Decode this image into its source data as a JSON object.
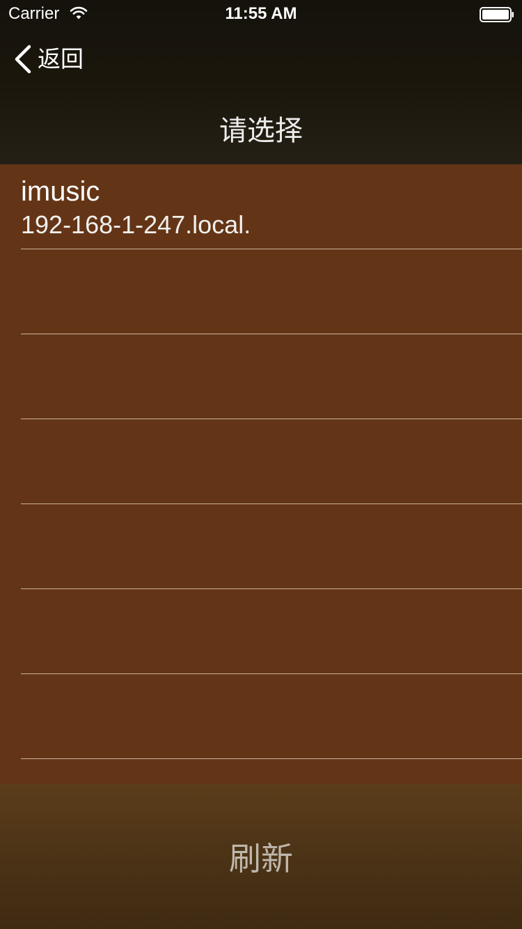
{
  "status_bar": {
    "carrier": "Carrier",
    "time": "11:55 AM",
    "wifi_icon": "wifi-icon",
    "battery_icon": "battery-icon"
  },
  "nav": {
    "back_label": "返回",
    "back_icon": "chevron-left-icon",
    "title": "请选择"
  },
  "list": {
    "items": [
      {
        "title": "imusic",
        "subtitle": "192-168-1-247.local."
      },
      {
        "title": "",
        "subtitle": ""
      },
      {
        "title": "",
        "subtitle": ""
      },
      {
        "title": "",
        "subtitle": ""
      },
      {
        "title": "",
        "subtitle": ""
      },
      {
        "title": "",
        "subtitle": ""
      },
      {
        "title": "",
        "subtitle": ""
      }
    ]
  },
  "footer": {
    "refresh_label": "刷新"
  },
  "colors": {
    "list_background": "#633516",
    "header_background": "#1c170d",
    "footer_background": "#4a3216",
    "separator": "#f0dcc8"
  }
}
